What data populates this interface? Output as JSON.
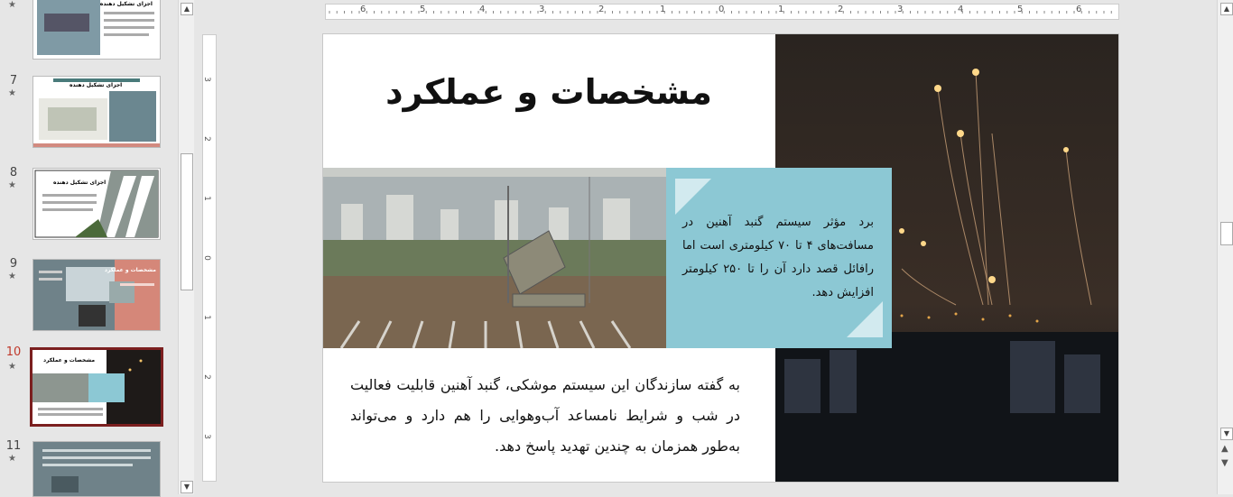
{
  "thumbnails": [
    {
      "num": "",
      "title": "اجزای تشکیل دهنده"
    },
    {
      "num": "7",
      "title": "اجزای تشکیل دهنده"
    },
    {
      "num": "8",
      "title": "اجزای تشکیل دهنده"
    },
    {
      "num": "9",
      "title": "مشخصات و عملکرد"
    },
    {
      "num": "10",
      "title": "مشخصات و عملکرد"
    },
    {
      "num": "11",
      "title": ""
    }
  ],
  "star": "★",
  "ruler": {
    "h_ticks": [
      "6",
      "5",
      "4",
      "3",
      "2",
      "1",
      "0",
      "1",
      "2",
      "3",
      "4",
      "5",
      "6"
    ],
    "v_ticks": [
      "3",
      "2",
      "1",
      "0",
      "1",
      "2",
      "3"
    ]
  },
  "slide": {
    "title": "مشخصات و عملکرد",
    "box_text": "برد مؤثر سیستم گنبد آهنین در مسافت‌های ۴ تا ۷۰ کیلومتری است اما رافائل قصد دارد آن را تا ۲۵۰ کیلومتر افزایش دهد.",
    "body_text": "به گفته سازندگان این سیستم موشکی، گنبد آهنین قابلیت فعالیت در شب و شرایط نامساعد آب‌وهوایی را هم دارد و می‌تواند به‌طور همزمان به چندین تهدید پاسخ دهد."
  },
  "scroll": {
    "up": "▲",
    "down": "▼"
  },
  "colors": {
    "accent_box": "#8cc8d4",
    "active_border": "#7b1f1f",
    "active_num": "#c0392b"
  }
}
